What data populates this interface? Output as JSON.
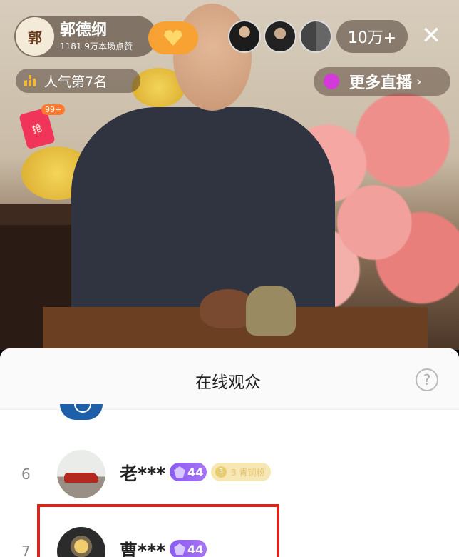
{
  "host": {
    "name": "郭德纲",
    "avatar_text": "郭",
    "likes": "1181.9万本场点赞"
  },
  "viewer_count": "10万+",
  "popularity_rank": "人气第7名",
  "more_live_label": "更多直播",
  "red_packet_badge": "99+",
  "red_packet_text": "抢",
  "sheet": {
    "title": "在线观众",
    "help": "?"
  },
  "audience": [
    {
      "rank": "6",
      "name": "老***",
      "level": "44",
      "fan_badge": "3 青铜粉",
      "fan_badge_icon": "3"
    },
    {
      "rank": "7",
      "name": "曹***",
      "level": "44"
    }
  ],
  "colors": {
    "follow": "#f7a233",
    "level_badge": "#8a5cf0",
    "highlight": "#d6271f"
  },
  "icons": [
    "heart-icon",
    "close-icon",
    "bars-icon",
    "live-icon",
    "chevron-right-icon",
    "help-icon",
    "gem-icon"
  ]
}
